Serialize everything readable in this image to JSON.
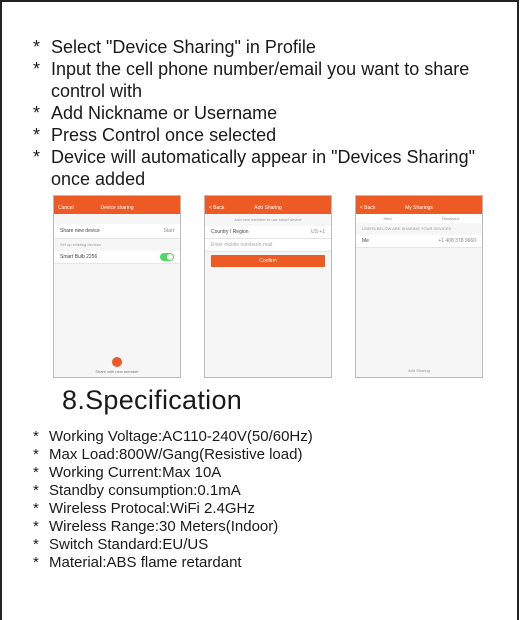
{
  "steps": [
    "Select \"Device Sharing\" in Profile",
    "Input the cell phone number/email you want to share control with",
    "Add Nickname or Username",
    "Press Control once selected",
    "Device will automatically appear in \"Devices Sharing\" once added"
  ],
  "phone1": {
    "left": "Cancel",
    "title": "Device sharing",
    "share_label": "Share new device",
    "share_action": "Start",
    "section": "Set up existing devices",
    "device": "Smart Bulb 2256",
    "bottom": "Share with new member"
  },
  "phone2": {
    "left": "< Back",
    "title": "Add Sharing",
    "hint": "Add new member to use smart device",
    "country_label": "Country / Region",
    "country_value": "US +1",
    "input_placeholder": "Enter mobile number/e-mail",
    "confirm": "Confirm"
  },
  "phone3": {
    "left": "< Back",
    "title": "My Sharings",
    "tab1": "Sent",
    "tab2": "Received",
    "notice": "USERS BELOW ARE SHARING YOUR DEVICES",
    "user": "Me",
    "user_value": "+1 408 378 9660",
    "bottom": "Add Sharing"
  },
  "spec_title": "8.Specification",
  "specs": [
    "Working Voltage:AC110-240V(50/60Hz)",
    "Max Load:800W/Gang(Resistive load)",
    "Working Current:Max 10A",
    "Standby consumption:0.1mA",
    "Wireless Protocal:WiFi 2.4GHz",
    "Wireless Range:30 Meters(Indoor)",
    "Switch Standard:EU/US",
    "Material:ABS flame retardant"
  ],
  "colors": {
    "accent": "#ee5a24",
    "toggle": "#4cd964"
  }
}
